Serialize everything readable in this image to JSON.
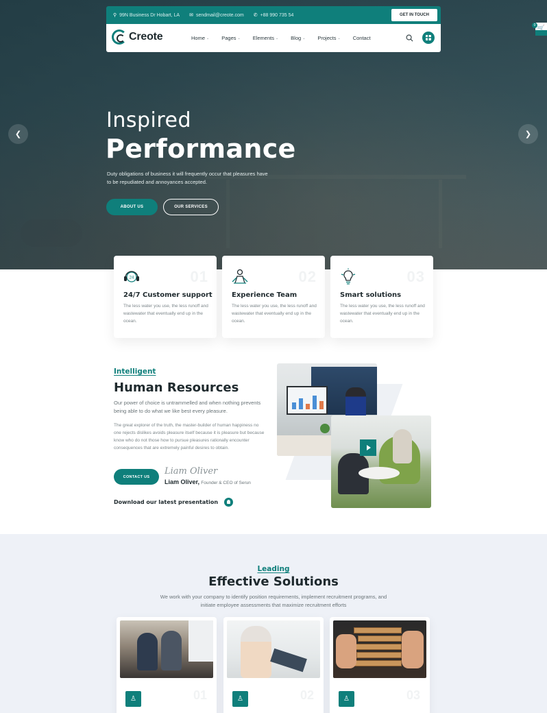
{
  "topbar": {
    "address": "99N Business Dr Hobart, LA",
    "email": "sendmail@creote.com",
    "phone": "+88 990 735 54",
    "cta": "GET IN TOUCH"
  },
  "brand": {
    "name": "Creote"
  },
  "nav": {
    "items": [
      {
        "label": "Home",
        "has_dropdown": true
      },
      {
        "label": "Pages",
        "has_dropdown": true
      },
      {
        "label": "Elements",
        "has_dropdown": true
      },
      {
        "label": "Blog",
        "has_dropdown": true
      },
      {
        "label": "Projects",
        "has_dropdown": true
      },
      {
        "label": "Contact",
        "has_dropdown": false
      }
    ],
    "search_icon": "search-icon",
    "menu_icon": "grid-menu-icon"
  },
  "cart": {
    "count": "0",
    "icon": "cart-icon"
  },
  "hero": {
    "subtitle": "Inspired",
    "title": "Performance",
    "description": "Duty obligations of business it will frequently occur that pleasures have to be repudiated and annoyances accepted.",
    "btn_primary": "ABOUT US",
    "btn_secondary": "OUR SERVICES",
    "prev_icon": "chevron-left-icon",
    "next_icon": "chevron-right-icon"
  },
  "features": [
    {
      "num": "01",
      "title": "24/7 Customer support",
      "desc": "The less water you use, the less runoff and wastewater that eventually end up in the ocean.",
      "icon": "headset-icon"
    },
    {
      "num": "02",
      "title": "Experience Team",
      "desc": "The less water you use, the less runoff and wastewater that eventually end up in the ocean.",
      "icon": "team-icon"
    },
    {
      "num": "03",
      "title": "Smart solutions",
      "desc": "The less water you use, the less runoff and wastewater that eventually end up in the ocean.",
      "icon": "lightbulb-icon"
    }
  ],
  "hr": {
    "eyebrow": "Intelligent",
    "title": "Human Resources",
    "p1": "Our power of choice is untrammelled and when nothing prevents being able to do what we like best every pleasure.",
    "p2": "The great explorer of the truth, the master-builder of human happiness no one rejects dislikes avoids pleasure itself because it is pleasure but because know who do not those how to pursue pleasures rationally encounter consequences that are extremely painful desires to obtain.",
    "btn": "CONTACT US",
    "signature": "Liam Oliver",
    "author_name": "Liam Oliver,",
    "author_role": "Founder & CEO of Serun",
    "download": "Download our latest presentation",
    "download_icon": "download-icon",
    "play_icon": "play-icon"
  },
  "solutions": {
    "eyebrow": "Leading",
    "title": "Effective Solutions",
    "desc": "We work with your company to identify position requirements, implement recruitment programs, and initiate employee assessments that maximize recruitment efforts",
    "cards": [
      {
        "num": "01",
        "icon": "chess-piece-icon"
      },
      {
        "num": "02",
        "icon": "chess-piece-icon"
      },
      {
        "num": "03",
        "icon": "chess-piece-icon"
      }
    ]
  },
  "colors": {
    "accent": "#0f7f7b",
    "dark": "#1f2a2e",
    "section_bg": "#eef1f7"
  }
}
